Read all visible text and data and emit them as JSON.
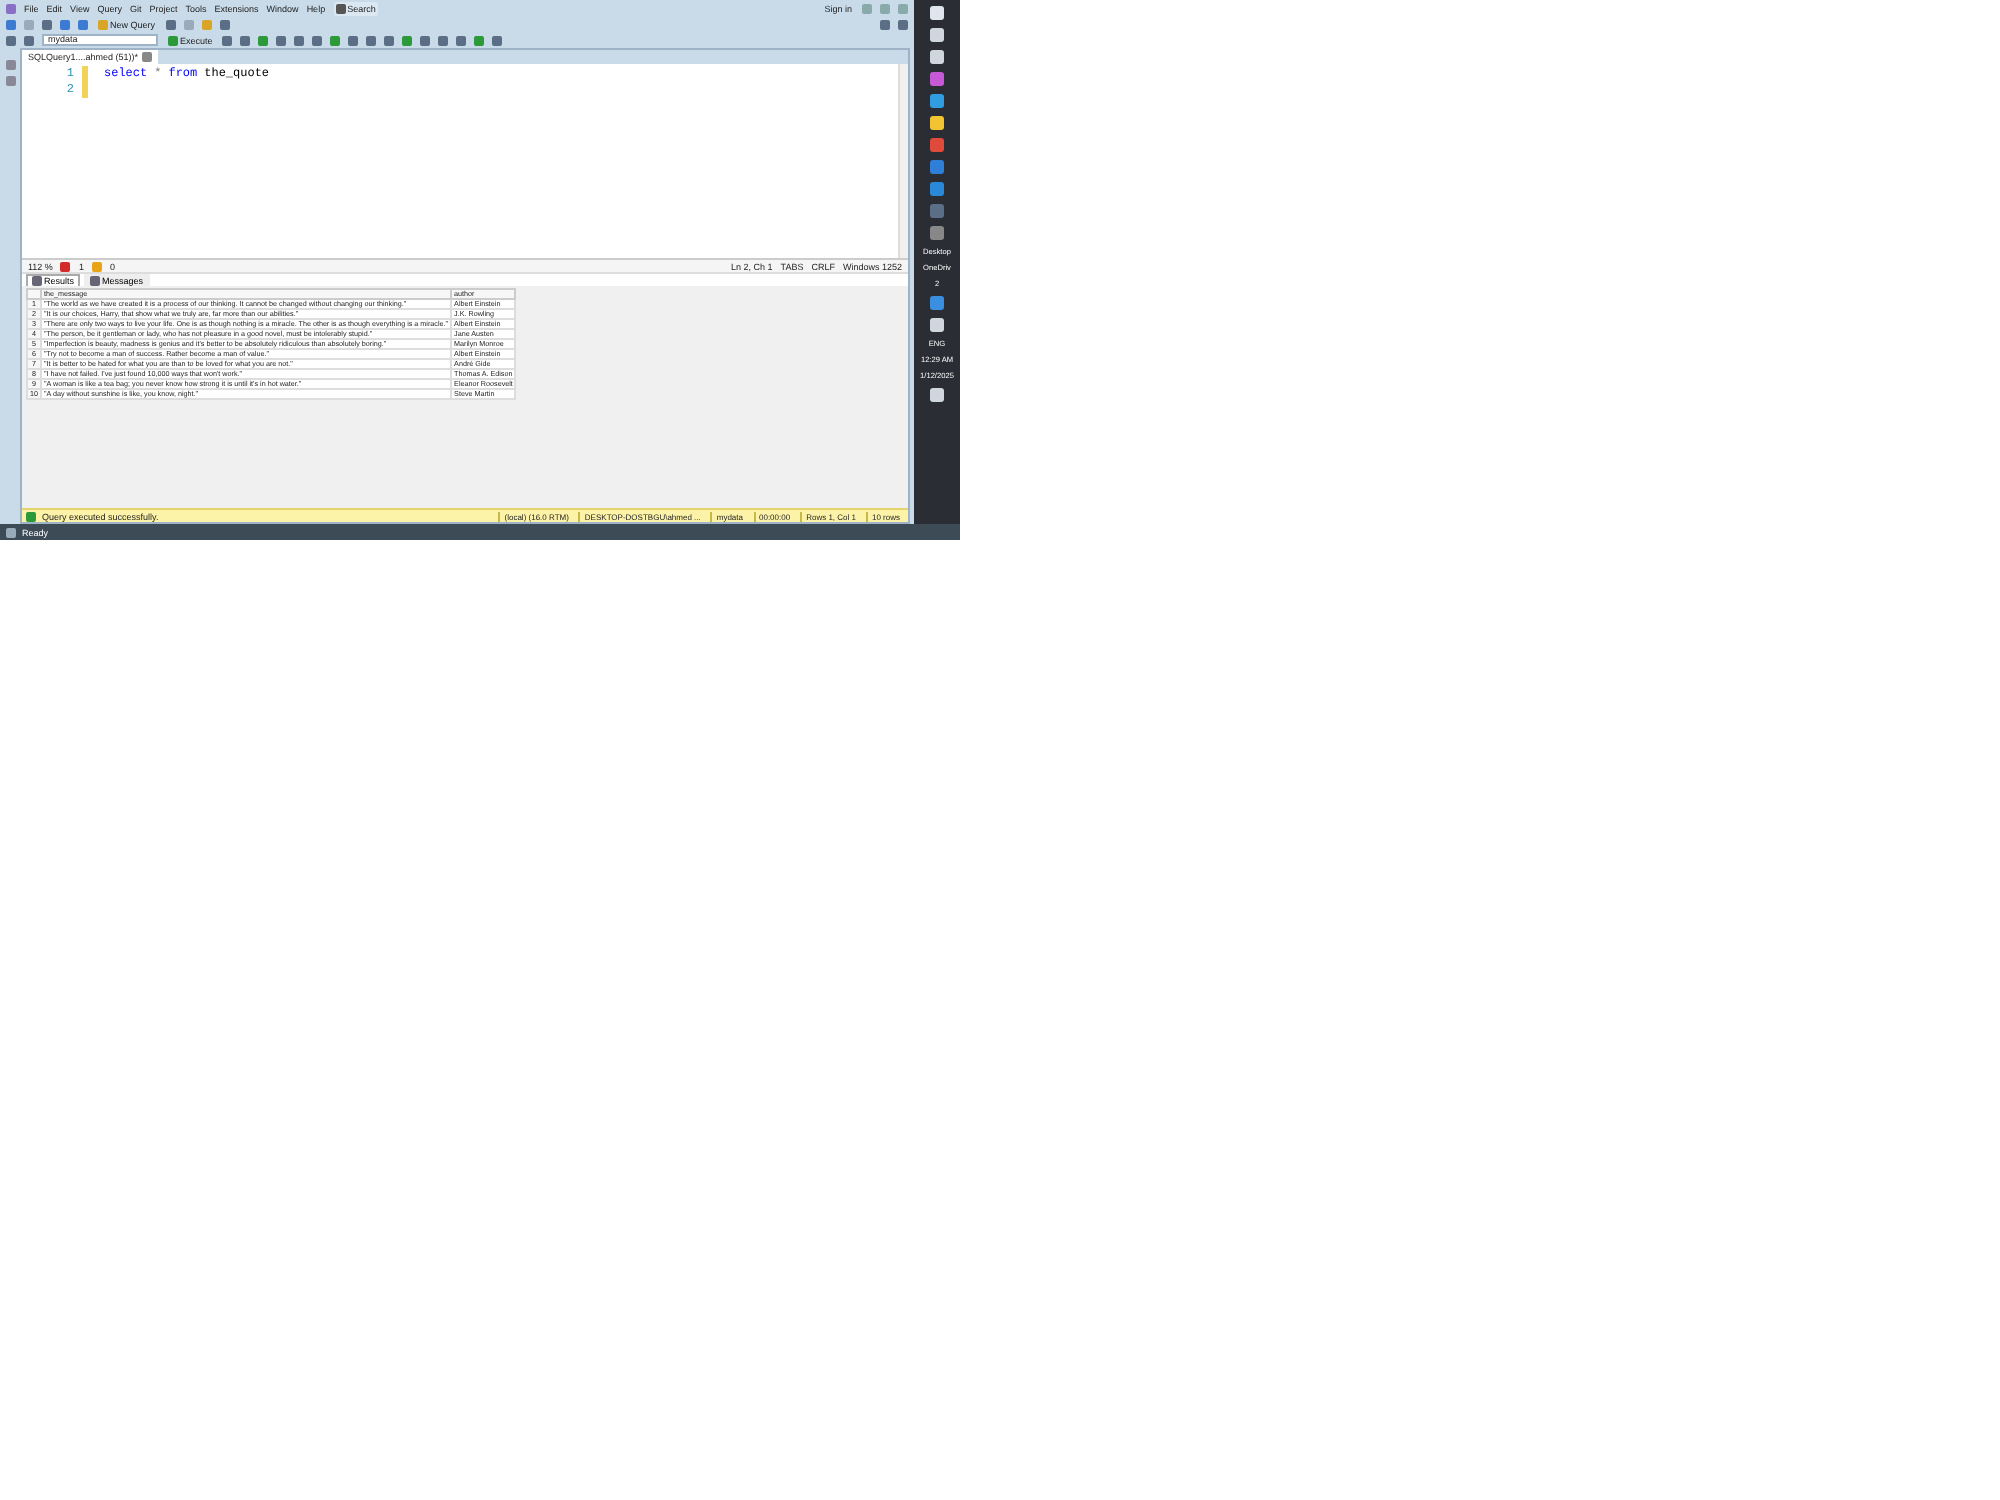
{
  "menu": [
    "File",
    "Edit",
    "View",
    "Query",
    "Git",
    "Project",
    "Tools",
    "Extensions",
    "Window",
    "Help"
  ],
  "search": {
    "label": "Search"
  },
  "sign_in": "Sign in",
  "toolbar": {
    "new_query": "New Query",
    "database": "mydata",
    "execute": "Execute"
  },
  "document_tab": {
    "title": "SQLQuery1....ahmed (51))*"
  },
  "editor": {
    "lines": [
      {
        "number": "1",
        "tokens": [
          {
            "kind": "keyword",
            "text": "select"
          },
          {
            "kind": "operator",
            "text": "*"
          },
          {
            "kind": "keyword",
            "text": "from"
          },
          {
            "kind": "identifier",
            "text": "the_quote"
          }
        ]
      },
      {
        "number": "2"
      }
    ]
  },
  "editor_status": {
    "zoom": "112 %",
    "errors": "1",
    "warnings": "0",
    "position": "Ln 2, Ch 1",
    "tabs": "TABS",
    "line_ending": "CRLF",
    "encoding": "Windows 1252"
  },
  "result_tabs": [
    {
      "label": "Results",
      "selected": true
    },
    {
      "label": "Messages",
      "selected": false
    }
  ],
  "table": {
    "columns": [
      "",
      "the_message",
      "author"
    ],
    "rows": [
      [
        "1",
        "\"The world as we have created it is a process of our thinking. It cannot be changed without changing our thinking.\"",
        "Albert Einstein"
      ],
      [
        "2",
        "\"It is our choices, Harry, that show what we truly are, far more than our abilities.\"",
        "J.K. Rowling"
      ],
      [
        "3",
        "\"There are only two ways to live your life. One is as though nothing is a miracle. The other is as though everything is a miracle.\"",
        "Albert Einstein"
      ],
      [
        "4",
        "\"The person, be it gentleman or lady, who has not pleasure in a good novel, must be intolerably stupid.\"",
        "Jane Austen"
      ],
      [
        "5",
        "\"Imperfection is beauty, madness is genius and it's better to be absolutely ridiculous than absolutely boring.\"",
        "Marilyn Monroe"
      ],
      [
        "6",
        "\"Try not to become a man of success. Rather become a man of value.\"",
        "Albert Einstein"
      ],
      [
        "7",
        "\"It is better to be hated for what you are than to be loved for what you are not.\"",
        "André Gide"
      ],
      [
        "8",
        "\"I have not failed. I've just found 10,000 ways that won't work.\"",
        "Thomas A. Edison"
      ],
      [
        "9",
        "\"A woman is like a tea bag; you never know how strong it is until it's in hot water.\"",
        "Eleanor Roosevelt"
      ],
      [
        "10",
        "\"A day without sunshine is like, you know, night.\"",
        "Steve Martin"
      ]
    ]
  },
  "query_status": {
    "message": "Query executed successfully.",
    "server": "(local) (16.0 RTM)",
    "login": "DESKTOP-DOSTBGU\\ahmed ...",
    "database": "mydata",
    "elapsed": "00:00:00",
    "position": "Rows 1, Col 1",
    "rows": "10 rows"
  },
  "status_bar": {
    "text": "Ready"
  },
  "taskbar": {
    "desktop": "Desktop",
    "onedrive": "OneDriv",
    "badge": "2",
    "language": "ENG",
    "time": "12:29 AM",
    "date": "1/12/2025"
  }
}
